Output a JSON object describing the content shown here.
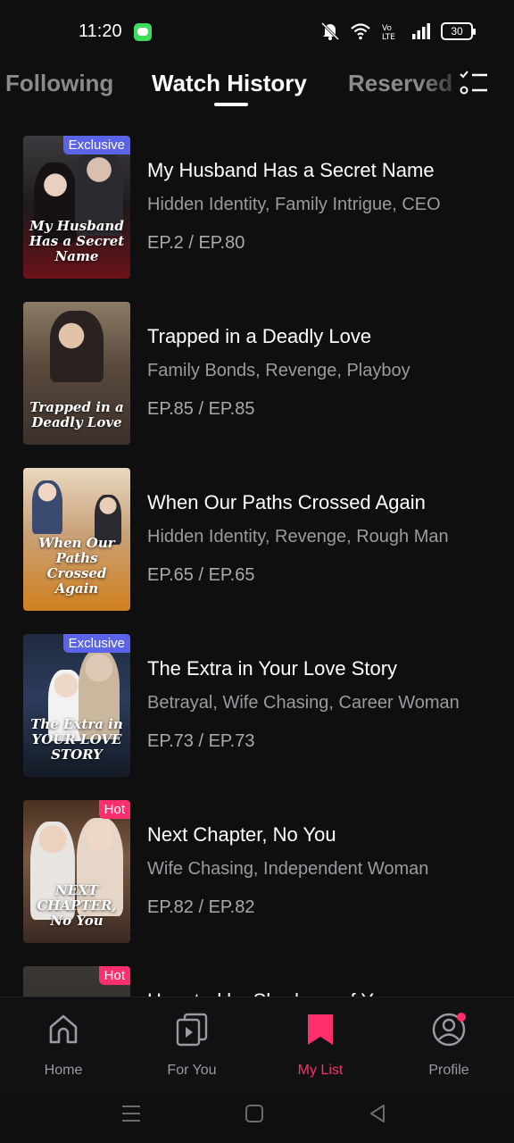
{
  "status_bar": {
    "time": "11:20",
    "battery": "30"
  },
  "tabs": [
    {
      "label": "Following"
    },
    {
      "label": "Watch History"
    },
    {
      "label": "Reserved"
    }
  ],
  "items": [
    {
      "title": "My Husband Has a Secret Name",
      "tags": "Hidden Identity, Family Intrigue, CEO",
      "progress": "EP.2 / EP.80",
      "badge": "Exclusive",
      "poster_text": "My Husband Has a Secret Name"
    },
    {
      "title": "Trapped in a Deadly Love",
      "tags": "Family Bonds, Revenge, Playboy",
      "progress": "EP.85 / EP.85",
      "badge": "",
      "poster_text": "Trapped in a Deadly Love"
    },
    {
      "title": "When Our Paths Crossed Again",
      "tags": "Hidden Identity, Revenge, Rough Man",
      "progress": "EP.65 / EP.65",
      "badge": "",
      "poster_text": "When Our Paths Crossed Again"
    },
    {
      "title": "The Extra in Your Love Story",
      "tags": "Betrayal, Wife Chasing, Career Woman",
      "progress": "EP.73 / EP.73",
      "badge": "Exclusive",
      "poster_text": "The Extra in YOUR LOVE STORY"
    },
    {
      "title": "Next Chapter, No You",
      "tags": "Wife Chasing, Independent Woman",
      "progress": "EP.82 / EP.82",
      "badge": "Hot",
      "poster_text": "NEXT CHAPTER, No You"
    },
    {
      "title": "Haunted by Shadows of You",
      "tags": "",
      "progress": "",
      "badge": "Hot",
      "poster_text": ""
    }
  ],
  "bottom_nav": [
    {
      "label": "Home"
    },
    {
      "label": "For You"
    },
    {
      "label": "My List"
    },
    {
      "label": "Profile"
    }
  ],
  "colors": {
    "accent": "#ff2f6d",
    "exclusive_badge": "#5b63e8",
    "background": "#0f0f10"
  }
}
